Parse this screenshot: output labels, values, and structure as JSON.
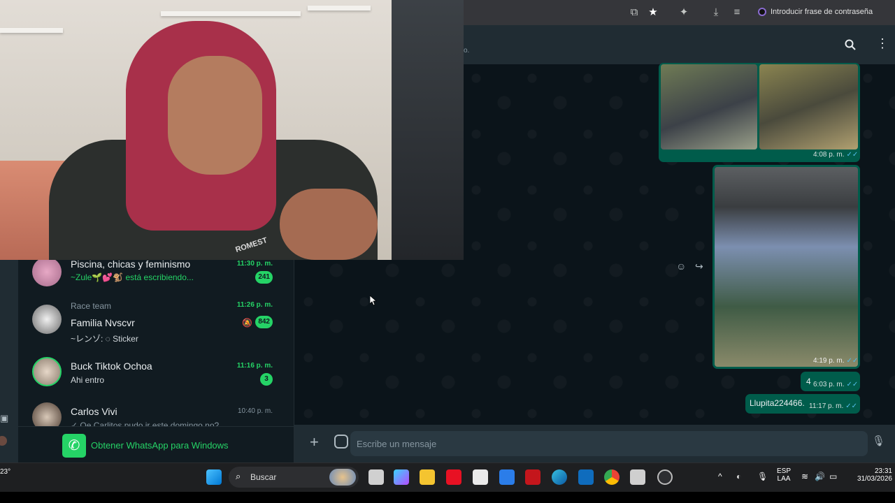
{
  "browser": {
    "password_button": "Introducir frase de contraseña"
  },
  "wa_header": {
    "hint_text": "o."
  },
  "messages": [
    {
      "time": "4:08 p. m."
    },
    {
      "time": "4:19 p. m."
    },
    {
      "text": "4",
      "time": "6:03 p. m."
    },
    {
      "text": "Llupita224466.",
      "time": "11:17 p. m."
    }
  ],
  "chats": [
    {
      "name": "Piscina, chicas y feminismo",
      "preview": "~Zule🌱💕🐒 está escribiendo...",
      "time": "11:30 p. m.",
      "badge": "241"
    },
    {
      "group": "Race team",
      "name": "Familia Nvscvr",
      "preview": "~レンゾ: ◌ Sticker",
      "time": "11:26 p. m.",
      "badge": "842"
    },
    {
      "name": "Buck Tiktok Ochoa",
      "preview": "Ahi entro",
      "time": "11:16 p. m.",
      "badge": "3"
    },
    {
      "name": "Carlos Vivi",
      "preview": "✓ Oe Carlitos pudo ir este domingo no?",
      "time": "10:40 p. m."
    }
  ],
  "get_whatsapp": "Obtener WhatsApp para Windows",
  "composer": {
    "placeholder": "Escribe un mensaje"
  },
  "webcam": {
    "shirt_text": "ROMEST"
  },
  "taskbar": {
    "weather": "23°",
    "search_placeholder": "Buscar",
    "lang_top": "ESP",
    "lang_bottom": "LAA",
    "time": "23:31",
    "date": "31/03/2026"
  }
}
